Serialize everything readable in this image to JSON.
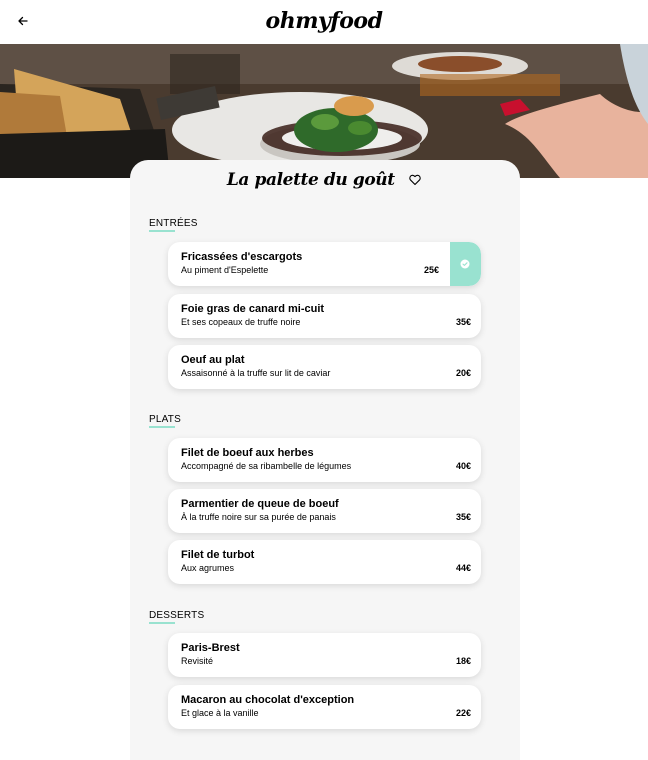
{
  "app": {
    "logo": "ohmyfood"
  },
  "restaurant": {
    "title": "La palette du goût"
  },
  "colors": {
    "accent": "#99e2d0",
    "card": "#f6f6f6"
  },
  "icons": {
    "back": "arrow-left-icon",
    "favorite": "heart-outline-icon",
    "selected": "check-circle-icon"
  },
  "sections": [
    {
      "title": "ENTRÉES",
      "dishes": [
        {
          "name": "Fricassées d'escargots",
          "desc": "Au piment d'Espelette",
          "price": "25€",
          "selected": true
        },
        {
          "name": "Foie gras de canard mi-cuit",
          "desc": "Et ses copeaux de truffe noire",
          "price": "35€"
        },
        {
          "name": "Oeuf au plat",
          "desc": "Assaisonné à la truffe sur lit de caviar",
          "price": "20€"
        }
      ]
    },
    {
      "title": "PLATS",
      "dishes": [
        {
          "name": "Filet de boeuf aux herbes",
          "desc": "Accompagné de sa ribambelle de légumes",
          "price": "40€"
        },
        {
          "name": "Parmentier de queue de boeuf",
          "desc": "À la truffe noire sur sa purée de panais",
          "price": "35€"
        },
        {
          "name": "Filet de turbot",
          "desc": "Aux agrumes",
          "price": "44€"
        }
      ]
    },
    {
      "title": "DESSERTS",
      "dishes": [
        {
          "name": "Paris-Brest",
          "desc": "Revisité",
          "price": "18€"
        },
        {
          "name": "Macaron au chocolat d'exception",
          "desc": "Et glace à la vanille",
          "price": "22€"
        }
      ]
    }
  ]
}
